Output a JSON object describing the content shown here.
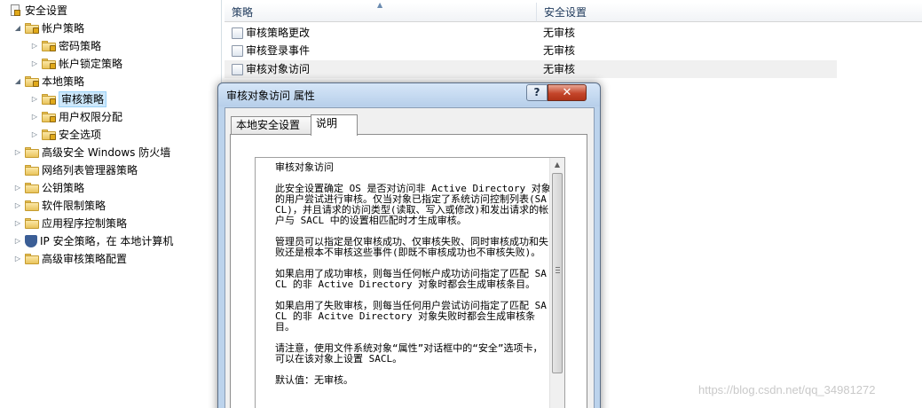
{
  "tree": {
    "root": "安全设置",
    "items": [
      {
        "label": "帐户策略",
        "expander": "◢"
      },
      {
        "label": "密码策略",
        "expander": "▷"
      },
      {
        "label": "帐户锁定策略",
        "expander": "▷"
      },
      {
        "label": "本地策略",
        "expander": "◢"
      },
      {
        "label": "审核策略",
        "expander": "▷"
      },
      {
        "label": "用户权限分配",
        "expander": "▷"
      },
      {
        "label": "安全选项",
        "expander": "▷"
      },
      {
        "label": "高级安全 Windows 防火墙",
        "expander": "▷"
      },
      {
        "label": "网络列表管理器策略",
        "expander": ""
      },
      {
        "label": "公钥策略",
        "expander": "▷"
      },
      {
        "label": "软件限制策略",
        "expander": "▷"
      },
      {
        "label": "应用程序控制策略",
        "expander": "▷"
      },
      {
        "label": "IP 安全策略，在 本地计算机",
        "expander": "▷"
      },
      {
        "label": "高级审核策略配置",
        "expander": "▷"
      }
    ]
  },
  "list": {
    "headers": {
      "policy": "策略",
      "setting": "安全设置"
    },
    "rows": [
      {
        "policy": "审核策略更改",
        "setting": "无审核"
      },
      {
        "policy": "审核登录事件",
        "setting": "无审核"
      },
      {
        "policy": "审核对象访问",
        "setting": "无审核"
      }
    ]
  },
  "dialog": {
    "title": "审核对象访问 属性",
    "help_label": "?",
    "close_label": "✕",
    "tabs": [
      {
        "label": "本地安全设置"
      },
      {
        "label": "说明"
      }
    ],
    "description": [
      "审核对象访问",
      "此安全设置确定 OS 是否对访问非 Active Directory 对象的用户尝试进行审核。仅当对象已指定了系统访问控制列表(SACL)，并且请求的访问类型(读取、写入或修改)和发出请求的帐户与 SACL 中的设置相匹配时才生成审核。",
      "管理员可以指定是仅审核成功、仅审核失败、同时审核成功和失败还是根本不审核这些事件(即既不审核成功也不审核失败)。",
      "如果启用了成功审核，则每当任何帐户成功访问指定了匹配 SACL 的非 Active Directory 对象时都会生成审核条目。",
      "如果启用了失败审核，则每当任何用户尝试访问指定了匹配 SACL 的非 Acitve Directory 对象失败时都会生成审核条目。",
      "请注意，使用文件系统对象“属性”对话框中的“安全”选项卡，可以在该对象上设置 SACL。",
      "默认值：无审核。"
    ]
  },
  "watermark": "https://blog.csdn.net/qq_34981272"
}
